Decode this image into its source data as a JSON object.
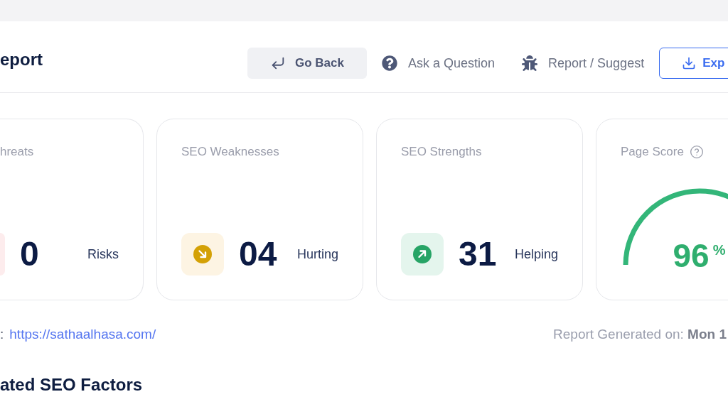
{
  "header": {
    "title": "eport",
    "actions": [
      {
        "kind": "back",
        "label": "Go Back"
      },
      {
        "kind": "help",
        "label": "Ask a Question"
      },
      {
        "kind": "report",
        "label": "Report / Suggest"
      },
      {
        "kind": "export",
        "label": "Exp"
      }
    ]
  },
  "stats": [
    {
      "kind": "threats",
      "title": "hreats",
      "count": "0",
      "label": "Risks"
    },
    {
      "kind": "weaknesses",
      "title": "SEO Weaknesses",
      "count": "04",
      "label": "Hurting"
    },
    {
      "kind": "strengths",
      "title": "SEO Strengths",
      "count": "31",
      "label": "Helping"
    }
  ],
  "score": {
    "title": "Page Score",
    "value": "96",
    "unit": "%",
    "level": 0.96
  },
  "url": {
    "label": ":",
    "link": "https://sathaalhasa.com/"
  },
  "report_date": "Report Generated on: **Mon 1**",
  "section": {
    "title": "ated SEO Factors"
  }
}
